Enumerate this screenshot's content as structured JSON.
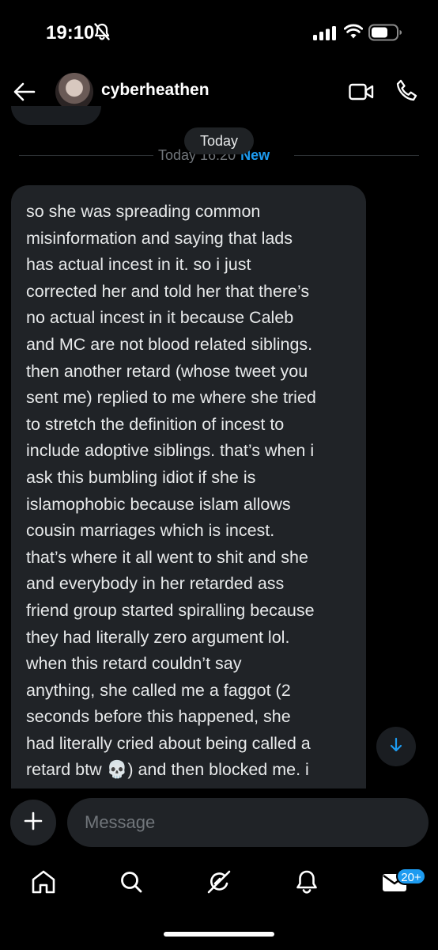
{
  "status_bar": {
    "time": "19:10",
    "icons": [
      "bell-slash-icon",
      "signal-icon",
      "wifi-icon",
      "battery-icon"
    ]
  },
  "header": {
    "username": "cyberheathen",
    "icons": [
      "back-arrow-icon",
      "avatar",
      "video-call-icon",
      "phone-call-icon"
    ]
  },
  "divider": {
    "floating_label": "Today",
    "timestamp": "Today 16:20",
    "new_label": "New"
  },
  "message": {
    "lines": [
      "so she was spreading common",
      "misinformation and saying that lads",
      "has actual incest in it. so i just",
      "corrected her and told her that there’s",
      "no actual incest in it because Caleb",
      "and MC are not blood related siblings.",
      "then another retard (whose tweet you",
      "sent me) replied to me where she tried",
      "to stretch the definition of incest to",
      "include adoptive siblings. that’s when i",
      "ask this bumbling idiot if she is",
      "islamophobic because islam allows",
      "cousin marriages which is incest.",
      "that’s where it all went to shit and she",
      "and everybody in her retarded ass",
      "friend group started spiralling because",
      "they had literally zero argument lol.",
      "when this retard couldn’t say",
      "anything, she called me a faggot (2",
      "seconds before this happened, she",
      "had literally cried about being called a",
      "retard btw 💀) and then blocked me. i"
    ],
    "emoji": "💀"
  },
  "composer": {
    "placeholder": "Message"
  },
  "tab_bar": {
    "items": [
      "home-icon",
      "search-icon",
      "grok-icon",
      "notifications-icon",
      "messages-icon"
    ],
    "messages_badge": "20+"
  },
  "colors": {
    "background": "#000000",
    "bubble": "#202327",
    "accent": "#1d9bf0",
    "muted": "#71767b",
    "text": "#e7e9ea"
  }
}
